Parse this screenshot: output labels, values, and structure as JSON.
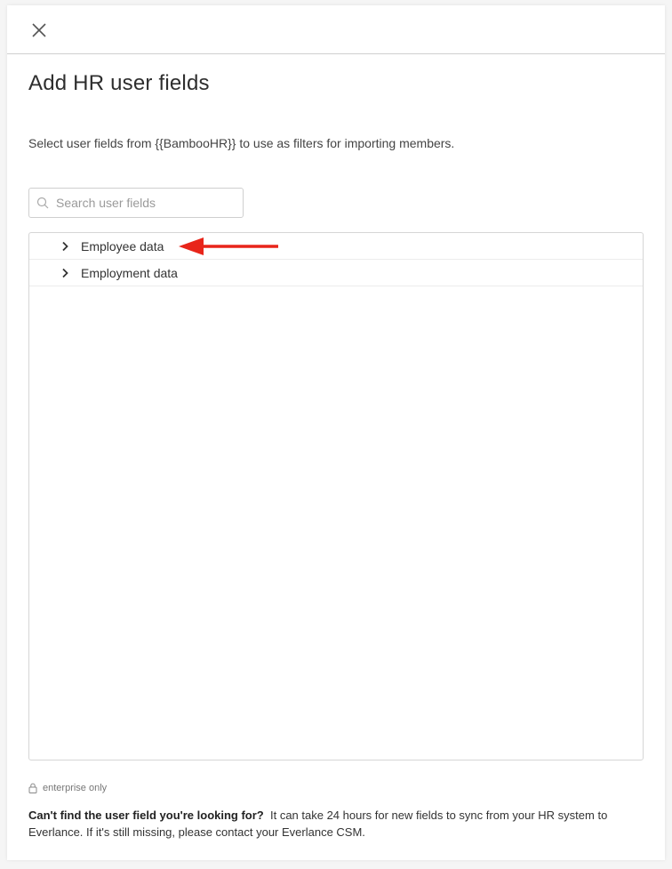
{
  "dialog": {
    "close_icon": "close-icon",
    "title": "Add HR user fields",
    "description": "Select user fields from {{BambooHR}} to use as filters for importing members."
  },
  "search": {
    "placeholder": "Search user fields",
    "value": "",
    "icon": "search-icon"
  },
  "tree": {
    "items": [
      {
        "label": "Employee data",
        "icon": "chevron-right-icon",
        "expanded": false
      },
      {
        "label": "Employment data",
        "icon": "chevron-right-icon",
        "expanded": false
      }
    ],
    "annotation_arrow_color": "#e8251a"
  },
  "footer": {
    "lock_icon": "lock-icon",
    "note": "enterprise only",
    "help_title": "Can't find the user field you're looking for?",
    "help_body": "It can take 24 hours for new fields to sync from your HR system to Everlance. If it's still missing, please contact your Everlance CSM."
  }
}
